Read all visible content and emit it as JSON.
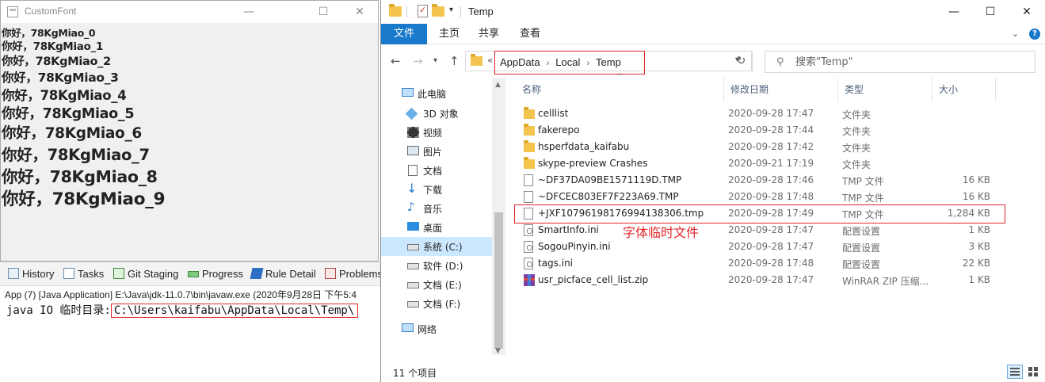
{
  "customfont": {
    "title": "CustomFont",
    "lines": [
      "你好，78KgMiao_0",
      "你好，78KgMiao_1",
      "你好，78KgMiao_2",
      "你好，78KgMiao_3",
      "你好，78KgMiao_4",
      "你好，78KgMiao_5",
      "你好，78KgMiao_6",
      "你好，78KgMiao_7",
      "你好，78KgMiao_8",
      "你好，78KgMiao_9"
    ]
  },
  "eclipse": {
    "tabs": [
      "History",
      "Tasks",
      "Git Staging",
      "Progress",
      "Rule Detail",
      "Problems"
    ],
    "launch_info": "App (7) [Java Application] E:\\Java\\jdk-11.0.7\\bin\\javaw.exe (2020年9月28日 下午5:4",
    "output_prefix": "java IO 临时目录:",
    "output_path": "C:\\Users\\kaifabu\\AppData\\Local\\Temp\\"
  },
  "explorer": {
    "title": "Temp",
    "ribbon_tabs": [
      "文件",
      "主页",
      "共享",
      "查看"
    ],
    "address": {
      "overflow": "«",
      "crumbs": [
        "AppData",
        "Local",
        "Temp"
      ]
    },
    "search_placeholder": "搜索\"Temp\"",
    "nav_items": [
      {
        "label": "此电脑",
        "icon": "computer-icon"
      },
      {
        "label": "3D 对象",
        "icon": "3d-objects-icon"
      },
      {
        "label": "视频",
        "icon": "video-icon"
      },
      {
        "label": "图片",
        "icon": "picture-icon"
      },
      {
        "label": "文档",
        "icon": "document-icon"
      },
      {
        "label": "下载",
        "icon": "download-icon"
      },
      {
        "label": "音乐",
        "icon": "music-icon"
      },
      {
        "label": "桌面",
        "icon": "desktop-icon"
      },
      {
        "label": "系统 (C:)",
        "icon": "drive-icon"
      },
      {
        "label": "软件 (D:)",
        "icon": "drive-icon"
      },
      {
        "label": "文档 (E:)",
        "icon": "drive-icon"
      },
      {
        "label": "文档 (F:)",
        "icon": "drive-icon"
      },
      {
        "label": "网络",
        "icon": "network-icon"
      }
    ],
    "columns": {
      "name": "名称",
      "date": "修改日期",
      "type": "类型",
      "size": "大小"
    },
    "files": [
      {
        "name": "celllist",
        "date": "2020-09-28 17:47",
        "type": "文件夹",
        "size": "",
        "icon": "folder"
      },
      {
        "name": "fakerepo",
        "date": "2020-09-28 17:44",
        "type": "文件夹",
        "size": "",
        "icon": "folder"
      },
      {
        "name": "hsperfdata_kaifabu",
        "date": "2020-09-28 17:42",
        "type": "文件夹",
        "size": "",
        "icon": "folder"
      },
      {
        "name": "skype-preview Crashes",
        "date": "2020-09-21 17:19",
        "type": "文件夹",
        "size": "",
        "icon": "folder"
      },
      {
        "name": "~DF37DA09BE1571119D.TMP",
        "date": "2020-09-28 17:46",
        "type": "TMP 文件",
        "size": "16 KB",
        "icon": "doc"
      },
      {
        "name": "~DFCEC803EF7F223A69.TMP",
        "date": "2020-09-28 17:48",
        "type": "TMP 文件",
        "size": "16 KB",
        "icon": "doc"
      },
      {
        "name": "+JXF10796198176994138306.tmp",
        "date": "2020-09-28 17:49",
        "type": "TMP 文件",
        "size": "1,284 KB",
        "icon": "doc"
      },
      {
        "name": "SmartInfo.ini",
        "date": "2020-09-28 17:47",
        "type": "配置设置",
        "size": "1 KB",
        "icon": "cfg"
      },
      {
        "name": "SogouPinyin.ini",
        "date": "2020-09-28 17:47",
        "type": "配置设置",
        "size": "3 KB",
        "icon": "cfg"
      },
      {
        "name": "tags.ini",
        "date": "2020-09-28 17:48",
        "type": "配置设置",
        "size": "22 KB",
        "icon": "cfg"
      },
      {
        "name": "usr_picface_cell_list.zip",
        "date": "2020-09-28 17:47",
        "type": "WinRAR ZIP 压缩...",
        "size": "1 KB",
        "icon": "zip"
      }
    ],
    "annotation": "字体临时文件",
    "status": "11 个项目"
  },
  "colors": {
    "accent": "#1979ca",
    "highlight": "#e0262a",
    "selected_bg": "#cce8ff"
  }
}
